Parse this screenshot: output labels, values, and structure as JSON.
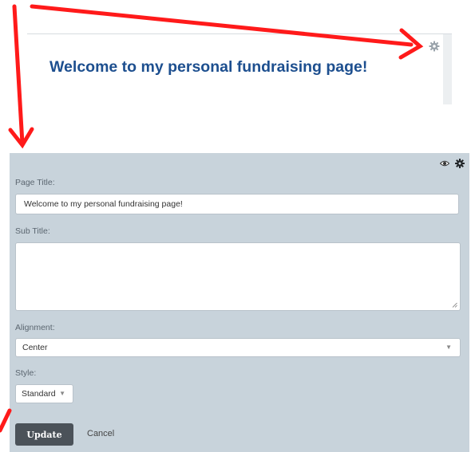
{
  "preview": {
    "title": "Welcome to my personal fundraising page!",
    "settings_icon": "gear-icon"
  },
  "panel": {
    "icons": [
      "eye-icon",
      "gear-icon"
    ],
    "page_title": {
      "label": "Page Title:",
      "value": "Welcome to my personal fundraising page!"
    },
    "sub_title": {
      "label": "Sub Title:",
      "value": ""
    },
    "alignment": {
      "label": "Alignment:",
      "value": "Center"
    },
    "style": {
      "label": "Style:",
      "value": "Standard"
    },
    "update_label": "Update",
    "cancel_label": "Cancel"
  },
  "colors": {
    "panel_bg": "#c8d3db",
    "title_blue": "#1d4f8f",
    "update_bg": "#4b5259",
    "annotation_red": "#ff1a1a"
  }
}
